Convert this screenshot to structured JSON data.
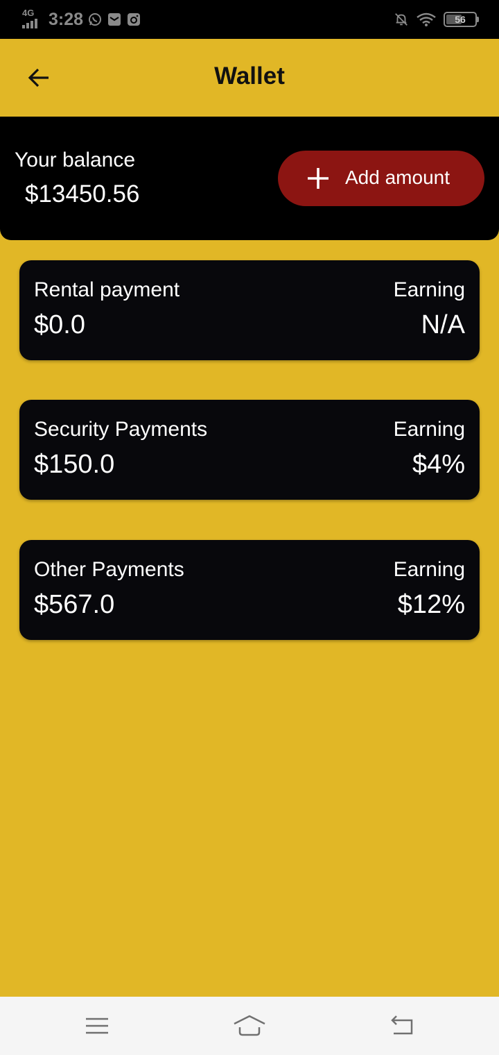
{
  "status_bar": {
    "network": "4G",
    "time": "3:28",
    "battery": "56",
    "battery_level": 0.56,
    "icons": [
      "whatsapp-icon",
      "mail-icon",
      "instagram-icon",
      "bell-off-icon",
      "wifi-icon",
      "battery-icon"
    ]
  },
  "header": {
    "title": "Wallet",
    "back_icon": "arrow-left-icon"
  },
  "balance": {
    "label": "Your balance",
    "value": "$13450.56",
    "add_label": "Add amount",
    "add_icon": "plus-icon"
  },
  "cards": [
    {
      "label": "Rental payment",
      "amount": "$0.0",
      "earning_label": "Earning",
      "earning_value": "N/A"
    },
    {
      "label": "Security Payments",
      "amount": "$150.0",
      "earning_label": "Earning",
      "earning_value": "$4%"
    },
    {
      "label": "Other Payments",
      "amount": "$567.0",
      "earning_label": "Earning",
      "earning_value": "$12%"
    }
  ],
  "nav": {
    "icons": [
      "menu-icon",
      "home-icon",
      "back-icon"
    ]
  },
  "colors": {
    "background": "#e1b726",
    "panel": "#000000",
    "card": "#08080c",
    "accent_button": "#8c1512",
    "text_light": "#ffffff",
    "text_dark": "#111111"
  }
}
